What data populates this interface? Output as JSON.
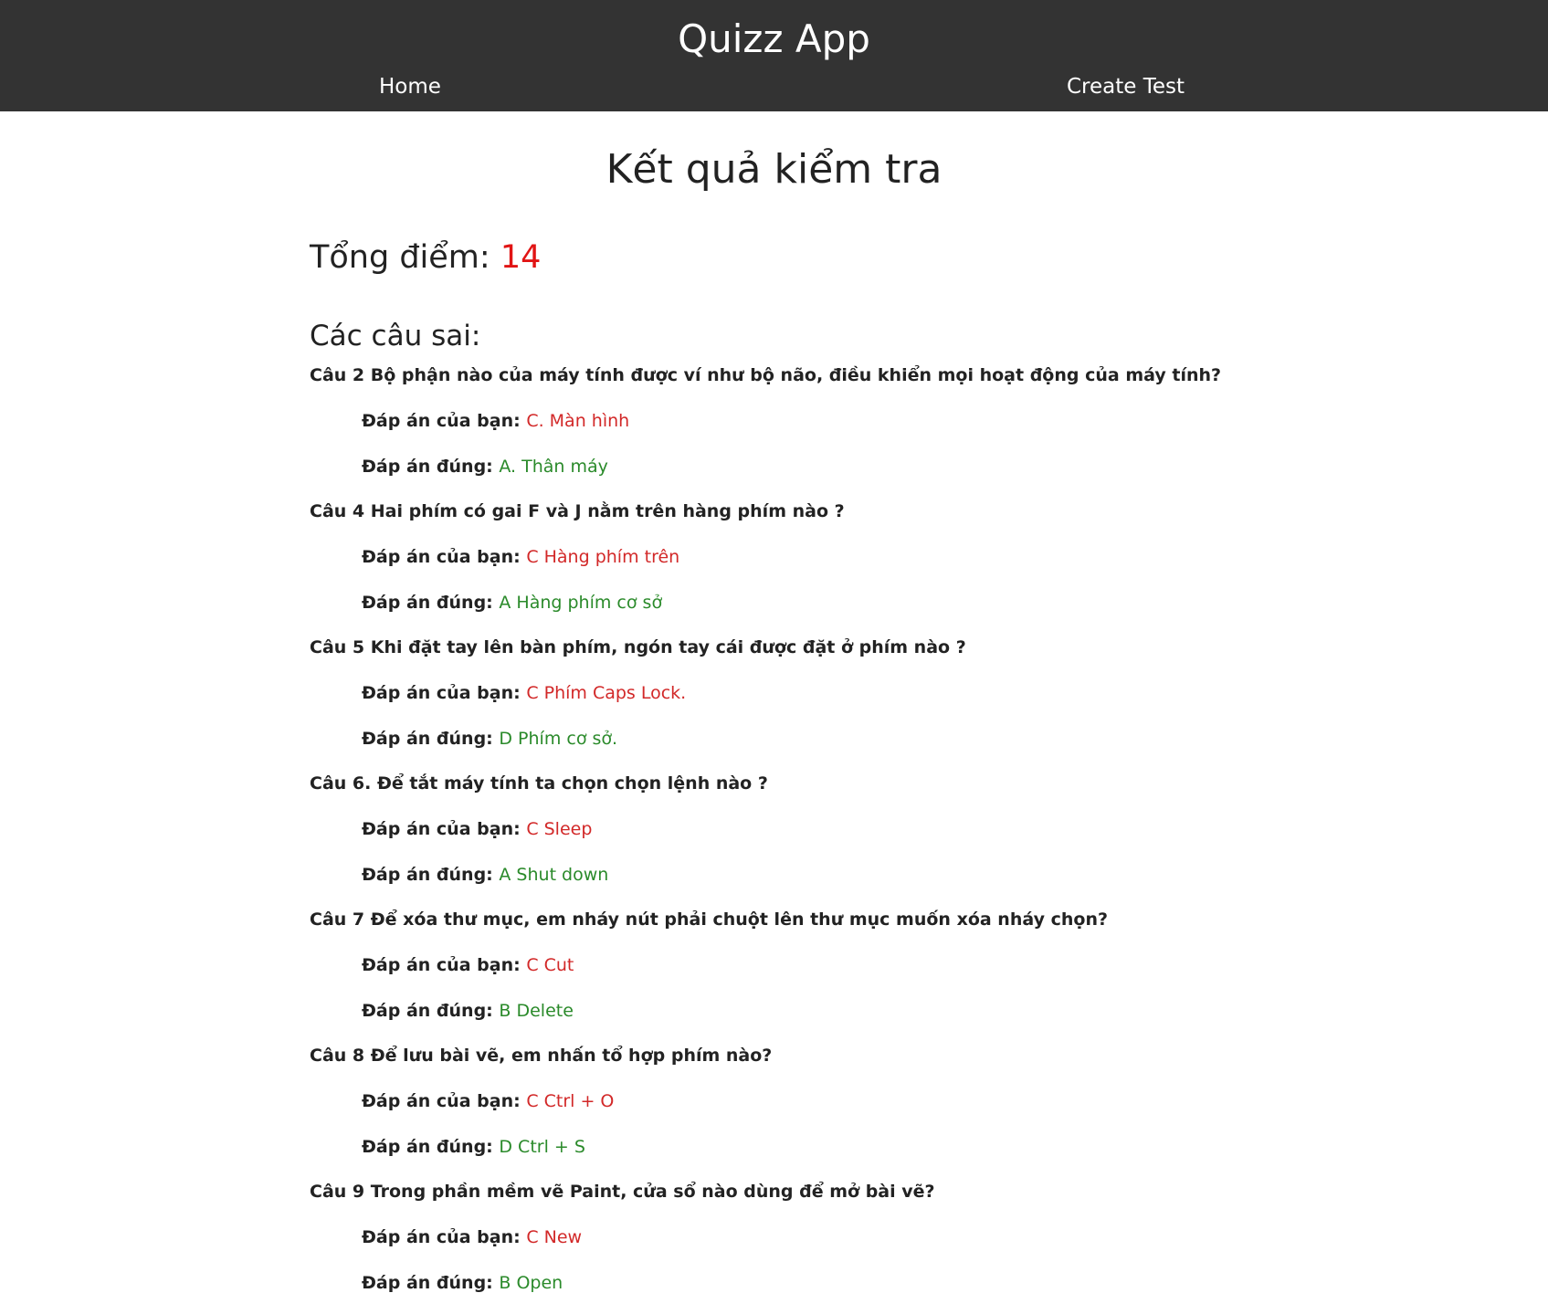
{
  "header": {
    "title": "Quizz App",
    "nav": {
      "home": "Home",
      "create_test": "Create Test"
    }
  },
  "main": {
    "page_title": "Kết quả kiểm tra",
    "score_label": "Tổng điểm: ",
    "score_value": "14",
    "wrong_heading": "Các câu sai:",
    "your_answer_label": "Đáp án của bạn: ",
    "correct_answer_label": "Đáp án đúng: ",
    "wrong_questions": [
      {
        "question": "Câu 2 Bộ phận nào của máy tính được ví như bộ não, điều khiển mọi hoạt động của máy tính?",
        "your_answer": "C. Màn hình",
        "correct_answer": "A. Thân máy"
      },
      {
        "question": "Câu 4 Hai phím có gai F và J nằm trên hàng phím nào ?",
        "your_answer": "C Hàng phím trên",
        "correct_answer": "A Hàng phím cơ sở"
      },
      {
        "question": "Câu 5 Khi đặt tay lên bàn phím, ngón tay cái được đặt ở phím nào ?",
        "your_answer": "C Phím Caps Lock.",
        "correct_answer": "D Phím cơ sở."
      },
      {
        "question": "Câu 6. Để tắt máy tính ta chọn chọn lệnh nào ?",
        "your_answer": "C Sleep",
        "correct_answer": "A Shut down"
      },
      {
        "question": "Câu 7 Để xóa thư mục, em nháy nút phải chuột lên thư mục muốn xóa nháy chọn?",
        "your_answer": "C Cut",
        "correct_answer": "B Delete"
      },
      {
        "question": "Câu 8 Để lưu bài vẽ, em nhấn tổ hợp phím nào?",
        "your_answer": "C Ctrl + O",
        "correct_answer": "D Ctrl + S"
      },
      {
        "question": "Câu 9 Trong phần mềm vẽ Paint, cửa sổ nào dùng để mở bài vẽ?",
        "your_answer": "C New",
        "correct_answer": "B Open"
      }
    ]
  },
  "colors": {
    "header_bg": "#333333",
    "score_value": "#e11414",
    "your_answer": "#d22828",
    "correct_answer": "#2a8a2a"
  }
}
